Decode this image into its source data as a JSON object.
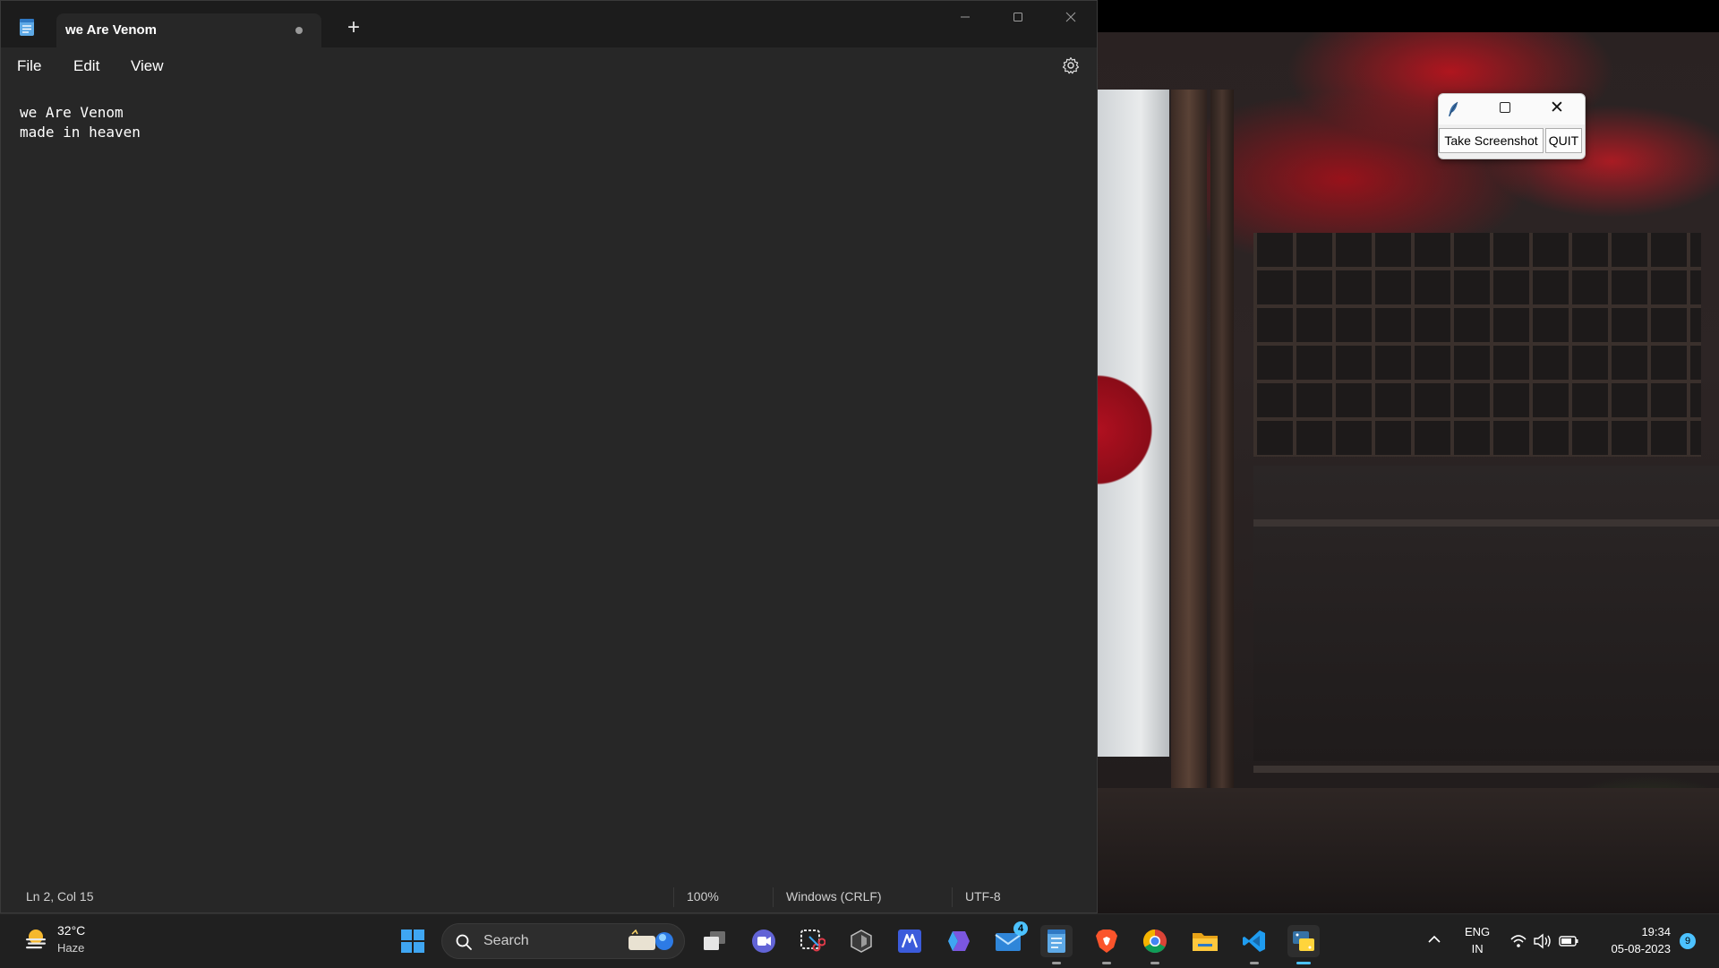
{
  "notepad": {
    "tab_title": "we Are Venom",
    "new_tab_label": "+",
    "menu": [
      "File",
      "Edit",
      "View"
    ],
    "content": "we Are Venom\nmade in heaven",
    "status": {
      "position": "Ln 2, Col 15",
      "zoom": "100%",
      "line_ending": "Windows (CRLF)",
      "encoding": "UTF-8"
    },
    "controls": {
      "minimize": "—",
      "maximize": "☐",
      "close": "✕"
    }
  },
  "tk_window": {
    "close_glyph": "✕",
    "buttons": {
      "screenshot": "Take Screenshot",
      "quit": "QUIT"
    }
  },
  "taskbar": {
    "weather": {
      "temp": "32°C",
      "condition": "Haze"
    },
    "search_label": "Search",
    "mail_badge": "4",
    "tray": {
      "chevron": "^",
      "lang_line1": "ENG",
      "lang_line2": "IN"
    },
    "clock": {
      "time": "19:34",
      "date": "05-08-2023"
    },
    "notification_count": "9",
    "apps": [
      "start",
      "search",
      "task-view",
      "teams",
      "snipping-tool",
      "app-unknown",
      "visual-studio-style",
      "copilot",
      "mail",
      "notepad",
      "brave",
      "chrome",
      "file-explorer",
      "vscode",
      "python"
    ]
  },
  "colors": {
    "accent": "#4cc2ff",
    "notepad_bg": "#272727",
    "titlebar_bg": "#1c1c1c",
    "taskbar_bg": "#202020"
  }
}
